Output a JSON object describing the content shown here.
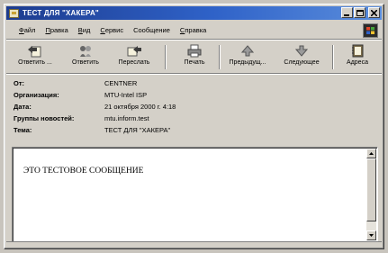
{
  "window": {
    "title": "ТЕСТ ДЛЯ \"ХАКЕРА\""
  },
  "menu": [
    {
      "accel": "Ф",
      "rest": "айл"
    },
    {
      "accel": "П",
      "rest": "равка"
    },
    {
      "accel": "В",
      "rest": "ид"
    },
    {
      "accel": "С",
      "rest": "ервис"
    },
    {
      "accel": "",
      "rest": "Сообщение"
    },
    {
      "accel": "С",
      "rest": "правка"
    }
  ],
  "toolbar": {
    "reply_sender": "Ответить ...",
    "reply_all": "Ответить",
    "forward": "Переслать",
    "print": "Печать",
    "previous": "Предыдущ...",
    "next": "Следующее",
    "addresses": "Адреса"
  },
  "headers": {
    "from_label": "От:",
    "from_value": "CENTNER",
    "org_label": "Организация:",
    "org_value": "MTU-Intel ISP",
    "date_label": "Дата:",
    "date_value": "21 октября 2000 г. 4:18",
    "groups_label": "Группы новостей:",
    "groups_value": "mtu.inform.test",
    "subject_label": "Тема:",
    "subject_value": "ТЕСТ ДЛЯ \"ХАКЕРА\""
  },
  "message": {
    "body": "ЭТО ТЕСТОВОЕ СООБЩЕНИЕ"
  },
  "icons": {
    "app": "message-icon",
    "minimize": "minimize-icon",
    "maximize": "maximize-icon",
    "close": "close-icon",
    "logo": "windows-logo-icon"
  },
  "colors": {
    "titlebar": "#1d3c8f",
    "face": "#d4d0c8"
  }
}
